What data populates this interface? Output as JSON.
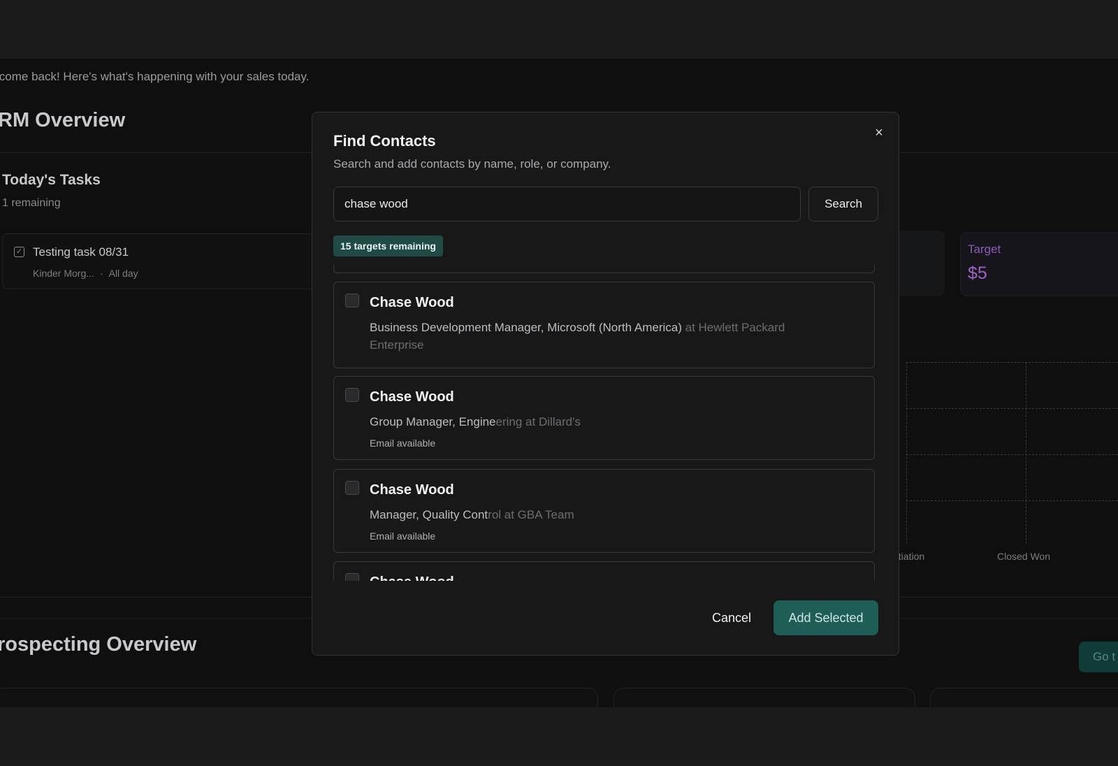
{
  "background": {
    "welcome_text": "lcome back! Here's what's happening with your sales today.",
    "crm_title": "RM Overview",
    "tasks": {
      "title": "Today's Tasks",
      "subtitle": "1 remaining",
      "items": [
        {
          "title": "Testing task 08/31",
          "company": "Kinder Morg...",
          "time": "All day"
        }
      ]
    },
    "stat_card": {
      "label": "Target",
      "value": "$5"
    },
    "chart_axis_labels": [
      "otiation",
      "Closed Won"
    ],
    "prospecting_title": "rospecting Overview",
    "go_button_label": "Go t"
  },
  "modal": {
    "title": "Find Contacts",
    "subtitle": "Search and add contacts by name, role, or company.",
    "close_icon": "×",
    "search": {
      "value": "chase wood",
      "button_label": "Search"
    },
    "badge": "15 targets remaining",
    "results": [
      {
        "name": "Chase Wood",
        "role": "Business Development Manager, Microsoft (North America)",
        "role_dim": " at Hewlett Packard Enterprise",
        "email": ""
      },
      {
        "name": "Chase Wood",
        "role": "Group Manager, Engine",
        "role_dim": "ering at Dillard's",
        "email": "Email available"
      },
      {
        "name": "Chase Wood",
        "role": "Manager, Quality Cont",
        "role_dim": "rol at GBA Team",
        "email": "Email available"
      },
      {
        "name": "Chase Wood",
        "role": "",
        "role_dim": "",
        "email": ""
      }
    ],
    "cancel_label": "Cancel",
    "add_label": "Add Selected"
  },
  "colors": {
    "accent": "#1f5d57",
    "badge": "#1f4a45",
    "target_purple": "#9d63c7"
  }
}
